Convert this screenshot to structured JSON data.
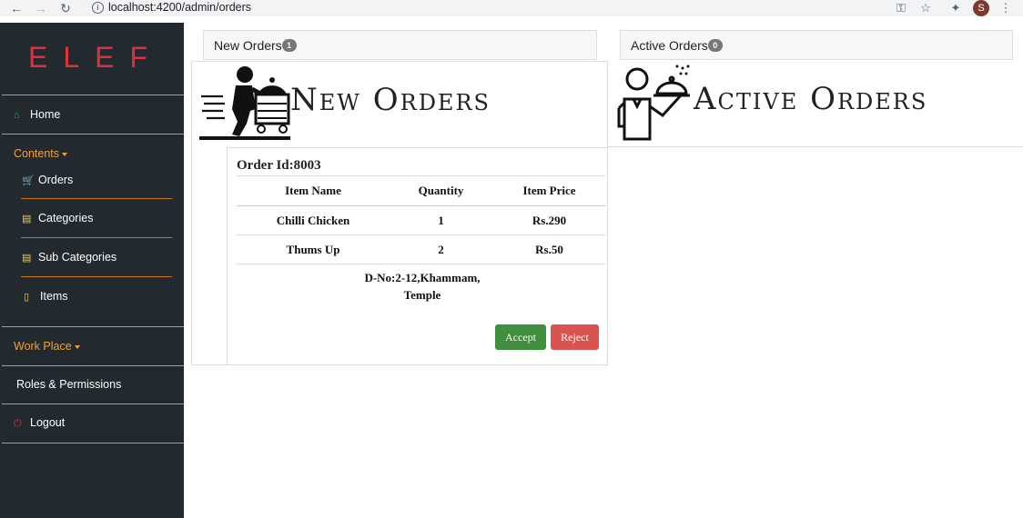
{
  "browser": {
    "url": "localhost:4200/admin/orders",
    "profile_initial": "S"
  },
  "sidebar": {
    "brand": "ELEF",
    "home": "Home",
    "contents": "Contents",
    "orders": "Orders",
    "categories": "Categories",
    "sub_categories": "Sub Categories",
    "items": "Items",
    "work_place": "Work Place",
    "roles": "Roles & Permissions",
    "logout": "Logout"
  },
  "tabs": {
    "new_orders": "New Orders",
    "new_orders_count": "1",
    "active_orders": "Active Orders",
    "active_orders_count": "0"
  },
  "hero": {
    "new_orders_title": "New Orders",
    "active_orders_title": "Active Orders"
  },
  "order": {
    "id_label": "Order Id:8003",
    "columns": [
      "Item Name",
      "Quantity",
      "Item Price"
    ],
    "rows": [
      [
        "Chilli Chicken",
        "1",
        "Rs.290"
      ],
      [
        "Thums Up",
        "2",
        "Rs.50"
      ]
    ],
    "address_line1": "D-No:2-12,Khammam,",
    "address_line2": "Temple",
    "accept_label": "Accept",
    "reject_label": "Reject"
  },
  "colors": {
    "sidebar_bg": "#222a30",
    "brand": "#e0303b",
    "section_orange": "#f0a23a",
    "accept": "#3f8f3e",
    "reject": "#d9544f"
  }
}
